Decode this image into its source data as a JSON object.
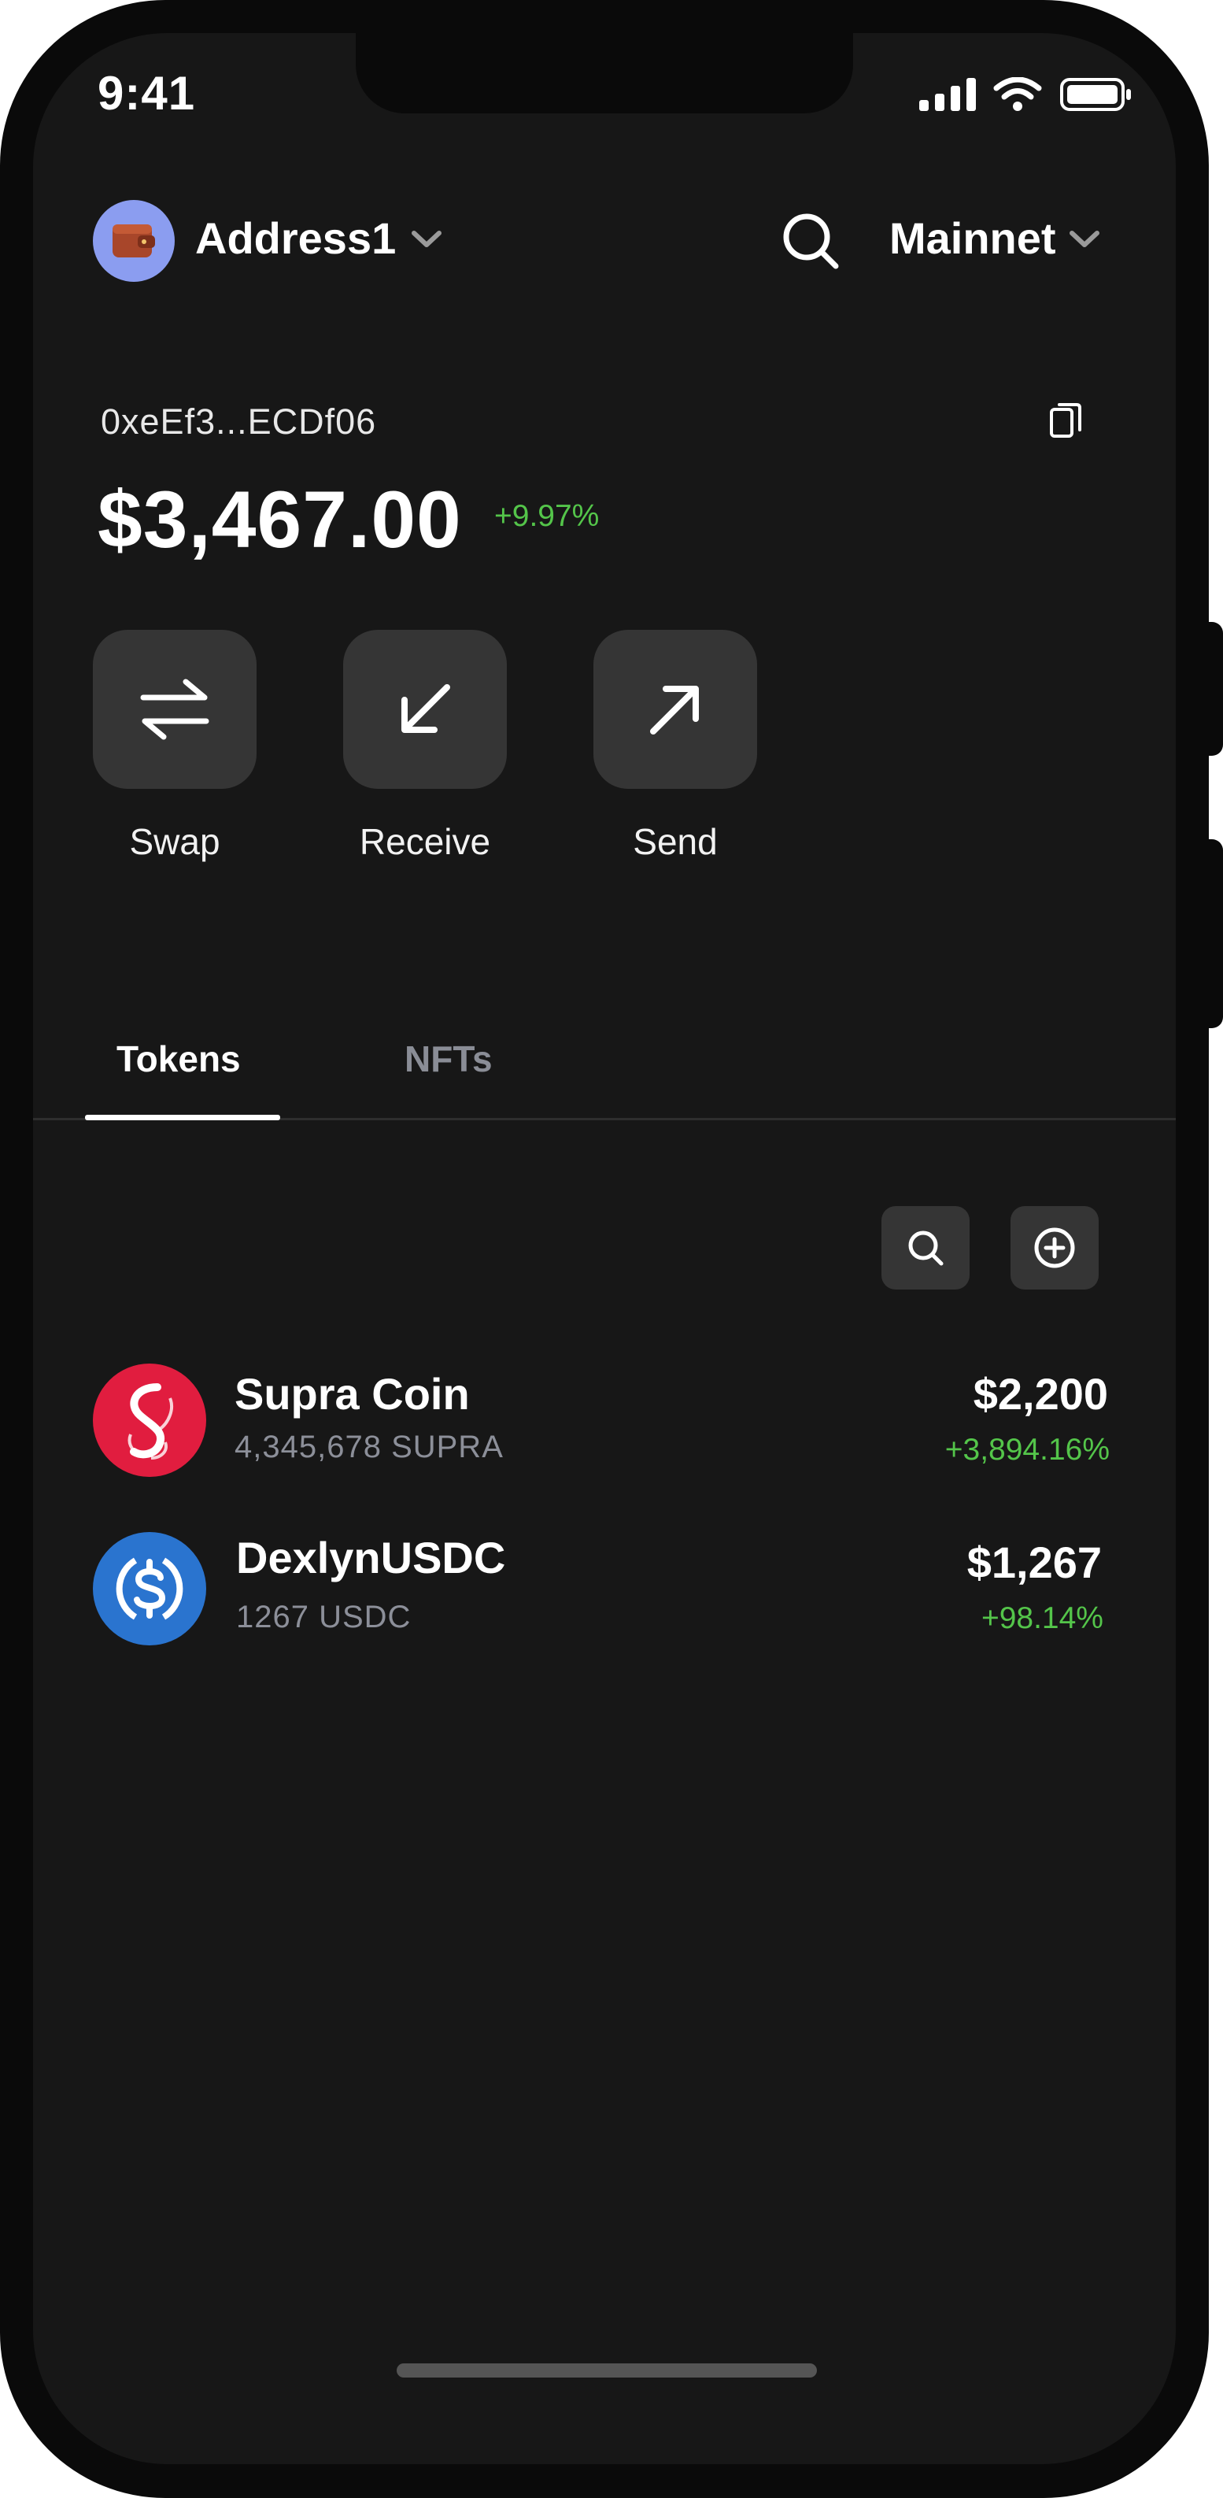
{
  "status_bar": {
    "time": "9:41"
  },
  "header": {
    "account_name": "Address1",
    "network": "Mainnet"
  },
  "wallet": {
    "address": "0xeEf3...ECDf06",
    "balance": "$3,467.00",
    "change": "+9.97%"
  },
  "actions": [
    {
      "label": "Swap",
      "icon": "swap-arrows-icon"
    },
    {
      "label": "Receive",
      "icon": "arrow-down-left-icon"
    },
    {
      "label": "Send",
      "icon": "arrow-up-right-icon"
    }
  ],
  "tabs": [
    {
      "label": "Tokens",
      "active": true
    },
    {
      "label": "NFTs",
      "active": false
    }
  ],
  "tokens": [
    {
      "name": "Supra Coin",
      "amount": "4,345,678 SUPRA",
      "value": "$2,200",
      "change": "+3,894.16%",
      "icon": "supra-coin-logo",
      "color": "#e11d3f"
    },
    {
      "name": "DexlynUSDC",
      "amount": "1267 USDC",
      "value": "$1,267",
      "change": "+98.14%",
      "icon": "usdc-logo",
      "color": "#2a74cf"
    }
  ],
  "colors": {
    "positive": "#54c54a",
    "background": "#171717",
    "button": "#353535",
    "avatar": "#8b9df0"
  }
}
